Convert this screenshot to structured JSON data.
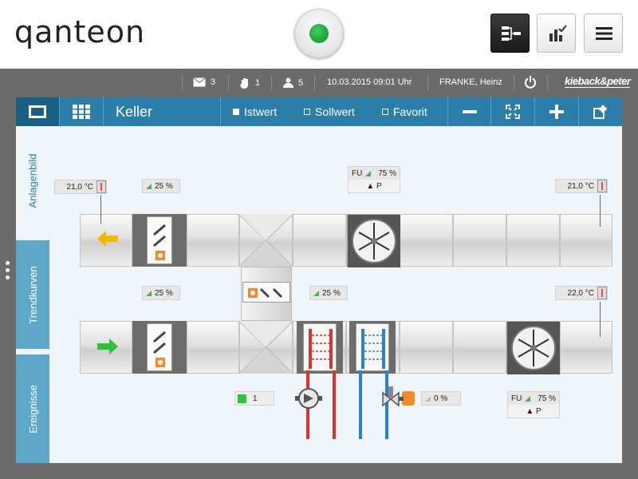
{
  "header": {
    "logo": "qanteon",
    "buttons": [
      {
        "icon": "schematic-icon",
        "active": true
      },
      {
        "icon": "chart-check-icon",
        "active": false
      },
      {
        "icon": "hamburger-menu-icon",
        "active": false
      }
    ],
    "status_color": "#1aa03a"
  },
  "infobar": {
    "messages_count": "3",
    "alarms_count": "1",
    "users_count": "5",
    "datetime": "10.03.2015  09:01 Uhr",
    "user": "FRANKE, Heinz",
    "brand": "kieback&peter"
  },
  "toolbar": {
    "title": "Keller",
    "istwert": "Istwert",
    "sollwert": "Sollwert",
    "favorit": "Favorit"
  },
  "sidebar": {
    "tabs": [
      "Anlagenbild",
      "Trendkurven",
      "Ereignisse"
    ]
  },
  "plant": {
    "temp_outside": "21,0 °C",
    "damper_top": "25 %",
    "fan_top_fu": "FU",
    "fan_top_pct": "75 %",
    "fan_top_mode": "▲ P",
    "temp_top_right": "21,0 °C",
    "damper_bottom": "25 %",
    "recirc_damper": "25 %",
    "temp_bottom_right": "22,0 °C",
    "pump_value": "1",
    "valve_pct": "0 %",
    "fan_bottom_fu": "FU",
    "fan_bottom_pct": "75 %",
    "fan_bottom_mode": "▲ P"
  },
  "colors": {
    "accent": "#2b7ea9",
    "tab": "#5ea7c9",
    "heating": "#d9362b",
    "cooling": "#2f7fd0",
    "arrow_exhaust": "#f2b800",
    "arrow_supply": "#2cc23b"
  }
}
